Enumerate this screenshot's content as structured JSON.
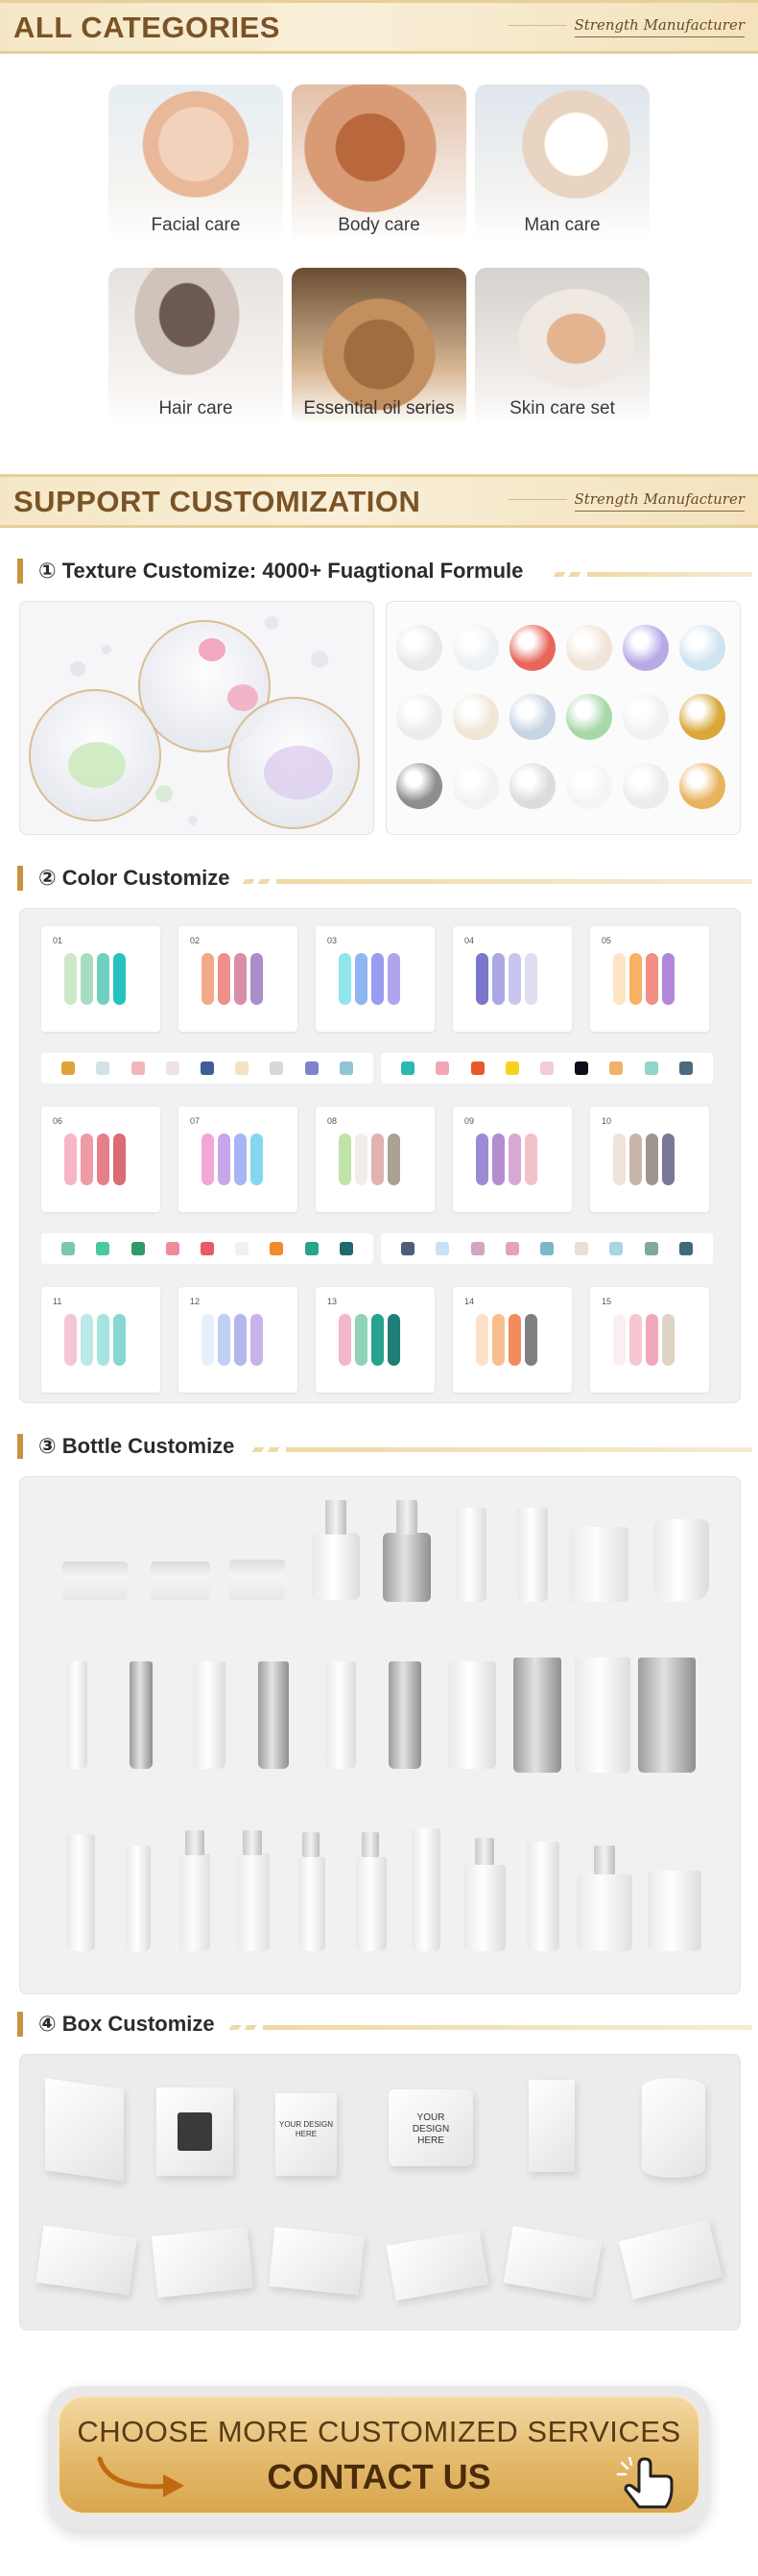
{
  "sections": {
    "categories": {
      "title": "ALL CATEGORIES",
      "tag": "Strength Manufacturer"
    },
    "customization": {
      "title": "SUPPORT CUSTOMIZATION",
      "tag": "Strength Manufacturer"
    }
  },
  "categories": [
    {
      "label": "Facial care"
    },
    {
      "label": "Body care"
    },
    {
      "label": "Man care"
    },
    {
      "label": "Hair care"
    },
    {
      "label": "Essential oil series"
    },
    {
      "label": "Skin care set"
    }
  ],
  "subsections": {
    "texture": "① Texture Customize: 4000+ Fuagtional Formule",
    "color": "② Color Customize",
    "bottle": "③ Bottle Customize",
    "box": "④ Box Customize"
  },
  "texture_blobs": [
    "#e9e9ec",
    "#eef1f4",
    "#e9665a",
    "#f0e3d8",
    "#b8a9e6",
    "#cfe3f1",
    "#ececec",
    "#efe7d4",
    "#c8d4e3",
    "#a8d8a8",
    "#f1f1f1",
    "#d9a73a",
    "#8e8e8e",
    "#f2f2f2",
    "#dcdcdc",
    "#f5f5f5",
    "#ececec",
    "#e7b35d"
  ],
  "palettes": [
    {
      "num": "01",
      "colors": [
        "#cfe8c8",
        "#a8dcc0",
        "#6fd0c0",
        "#25c2c0"
      ]
    },
    {
      "num": "02",
      "colors": [
        "#f4a98a",
        "#ee8f8a",
        "#d98ea8",
        "#a98ec9"
      ]
    },
    {
      "num": "03",
      "colors": [
        "#8fe6ec",
        "#8fb6f0",
        "#9a9cf0",
        "#b0a4ec"
      ]
    },
    {
      "num": "04",
      "colors": [
        "#7a76c9",
        "#aaa9e4",
        "#c8c6ee",
        "#dedef0"
      ]
    },
    {
      "num": "05",
      "colors": [
        "#fde4c4",
        "#f9b162",
        "#f28e84",
        "#b287d8"
      ]
    },
    {
      "num": "06",
      "colors": [
        "#f7b6c3",
        "#f09aa8",
        "#e67f8c",
        "#d96c74"
      ]
    },
    {
      "num": "07",
      "colors": [
        "#f4a6d4",
        "#c7a6ec",
        "#a6b6f4",
        "#86d6f0"
      ]
    },
    {
      "num": "08",
      "colors": [
        "#bfe3a8",
        "#f3ece7",
        "#e2b2b2",
        "#a9a295"
      ]
    },
    {
      "num": "09",
      "colors": [
        "#9d8ad4",
        "#b58cd0",
        "#d8a8d4",
        "#f2c2cc"
      ]
    },
    {
      "num": "10",
      "colors": [
        "#efe1dc",
        "#c9b6a8",
        "#9f9590",
        "#7a7896"
      ]
    },
    {
      "num": "11",
      "colors": [
        "#f4c6d4",
        "#bde8e8",
        "#a6e4e0",
        "#86d6d4"
      ]
    },
    {
      "num": "12",
      "colors": [
        "#e8eefc",
        "#bed0f4",
        "#b6b6ee",
        "#c8b2ea"
      ]
    },
    {
      "num": "13",
      "colors": [
        "#f3b6cb",
        "#8fd3b4",
        "#27a38e",
        "#1f7f78"
      ]
    },
    {
      "num": "14",
      "colors": [
        "#fde0c8",
        "#f9bf8f",
        "#f18b5c",
        "#7f7f7f"
      ]
    },
    {
      "num": "15",
      "colors": [
        "#fbeef0",
        "#f7c6d0",
        "#f0a8b8",
        "#dfd3c4"
      ]
    }
  ],
  "dot_rows": [
    [
      "#e0a338",
      "#cfe3e9",
      "#f4b4bc",
      "#f0e0e8",
      "#3e5c96",
      "#f4e2c4",
      "#d8d8d8",
      "#7b84c8",
      "#8fc6d4"
    ],
    [
      "#28b9b0",
      "#f0a6b4",
      "#e8582a",
      "#f5d41e",
      "#f4ccd8",
      "#0e0e1a",
      "#f0b26a",
      "#8fd6c8",
      "#4e6a7e"
    ],
    [
      "#7bc8b0",
      "#4ac8a0",
      "#2f9a68",
      "#f08a9a",
      "#e85a64",
      "#f0f0f0",
      "#f28a2a",
      "#2aa38c",
      "#1f6a6c"
    ],
    [
      "#4e5e7a",
      "#cce0f4",
      "#d4a4c0",
      "#e4a4b0",
      "#7ab8c8",
      "#e8e0d4",
      "#a8d4e4",
      "#7ea898",
      "#3e6a7c"
    ]
  ],
  "boxes": [
    {
      "text": ""
    },
    {
      "text": ""
    },
    {
      "text": "YOUR DESIGN HERE"
    },
    {
      "text": "YOUR DESIGN HERE"
    },
    {
      "text": ""
    },
    {
      "text": ""
    }
  ],
  "cta": {
    "line1": "CHOOSE MORE CUSTOMIZED SERVICES",
    "line2": "CONTACT US"
  }
}
